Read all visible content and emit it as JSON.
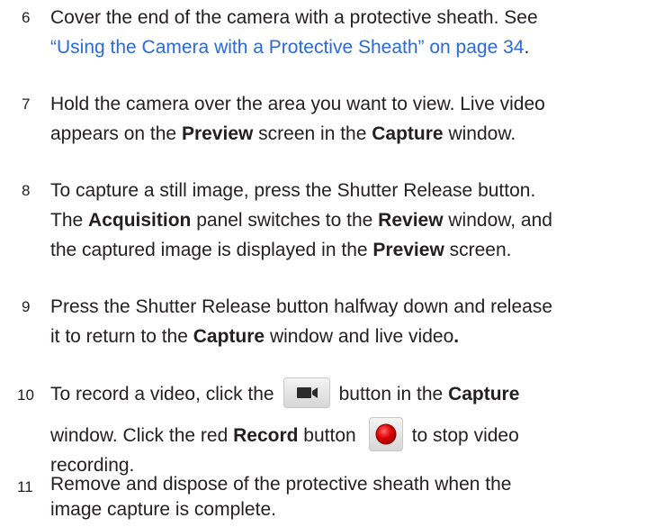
{
  "steps": [
    {
      "number": "6",
      "line1": "Cover the end of the camera with a protective sheath. See",
      "link": "“Using the Camera with a Protective Sheath” on page 34",
      "link_end": "."
    },
    {
      "number": "7",
      "line1": "Hold the camera over the area you want to view. Live video",
      "l2a": "appears on the ",
      "preview": "Preview",
      "l2b": " screen in the ",
      "capture": "Capture",
      "l2c": " window."
    },
    {
      "number": "8",
      "line1": "To capture a still image, press the Shutter Release button.",
      "l2a": "The ",
      "acquisition": "Acquisition",
      "l2b": " panel switches to the ",
      "review": "Review",
      "l2c": " window, and",
      "l3a": "the captured image is displayed in the ",
      "preview": "Preview",
      "l3b": " screen."
    },
    {
      "number": "9",
      "line1": "Press the Shutter Release button halfway down and release",
      "l2a": "it to return to the ",
      "capture": "Capture",
      "l2b": " window and live video",
      "l2c": "."
    },
    {
      "number": "10",
      "l1a": "To record a video, click the",
      "l1b": "button in the ",
      "capture": "Capture",
      "l2a": "window. Click the red ",
      "record": "Record",
      "l2b": " button",
      "l2c": "to stop video",
      "line3": "recording."
    },
    {
      "number": "11",
      "line1": "Remove and dispose of the protective sheath when the",
      "line2": "image capture is complete."
    }
  ],
  "icons": {
    "video_camera": "video-camera-icon",
    "record": "record-icon"
  },
  "colors": {
    "link": "#2a6ad9",
    "record_red": "#e00000"
  }
}
